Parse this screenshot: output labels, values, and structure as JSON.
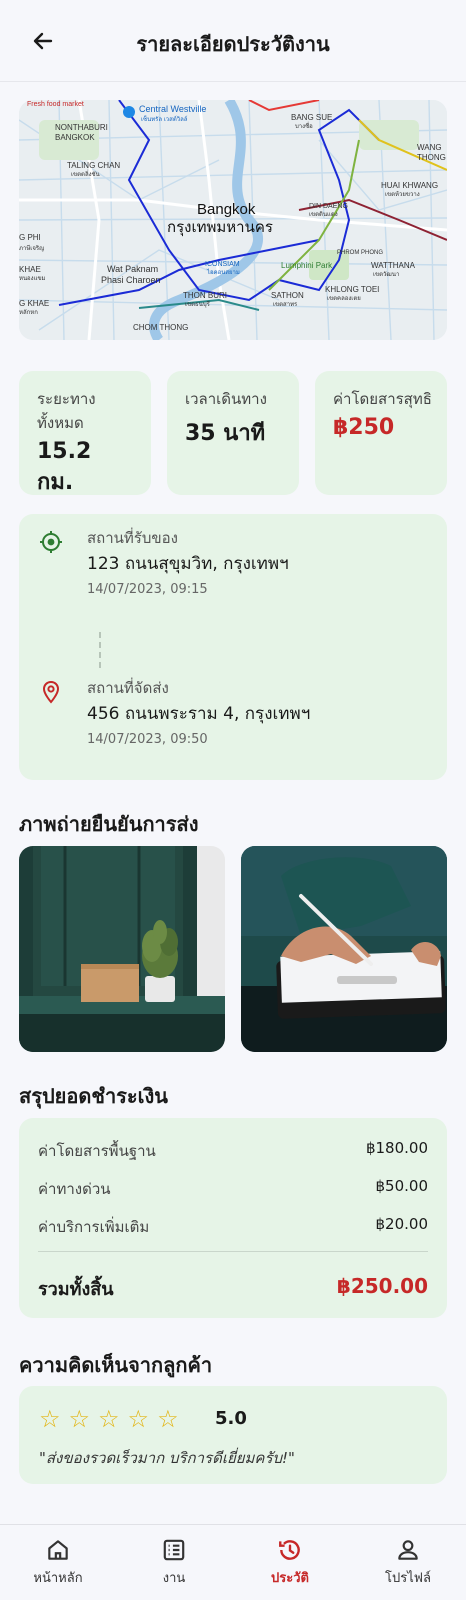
{
  "header": {
    "title": "รายละเอียดประวัติงาน"
  },
  "map": {
    "labels": {
      "fresh_food": "Fresh food market",
      "central_westville": "Central Westville",
      "central_westville_th": "เซ็นทรัล เวสต์วิลล์",
      "nonthaburi": "NONTHABURI",
      "bangkok_noi": "BANGKOK",
      "taling_chan": "TALING CHAN",
      "taling_chan_th": "เขตตลิ่งชัน",
      "bang_sue": "BANG SUE",
      "bang_sue_th": "บางซื่อ",
      "wang": "WANG",
      "thong": "THONG",
      "huai_khwang": "HUAI KHWANG",
      "huai_khwang_th": "เขตห้วยขวาง",
      "bangkok": "Bangkok",
      "bangkok_th": "กรุงเทพมหานคร",
      "din_daeng": "DIN DAENG",
      "din_daeng_th": "เขตดินแดง",
      "phi_a": "G PHI",
      "phi_th": "ภาษีเจริญ",
      "lumphini": "Lumphini Park",
      "phrom_phong": "PHROM PHONG",
      "watthana": "WATTHANA",
      "watthana_th": "เขตวัฒนา",
      "iconsiam": "ICONSIAM",
      "iconsiam_th": "ไอคอนสยาม",
      "wat_paknam": "Wat Paknam",
      "wat_paknam_sub": "Phasi Charoen",
      "thon_buri": "THON BURI",
      "thon_buri_th": "เขตธนบุรี",
      "sathon": "SATHON",
      "sathon_th": "เขตสาทร",
      "khlong_toei": "KHLONG TOEI",
      "khlong_toei_th": "เขตคลองเตย",
      "chom_thong": "CHOM THONG",
      "khae": "KHAE",
      "khae_th": "หนองแขม",
      "g_khae": "G KHAE",
      "g_khae_th": "หลักหก"
    }
  },
  "stats": [
    {
      "label": "ระยะทางทั้งหมด",
      "value": "15.2 กม."
    },
    {
      "label": "เวลาเดินทาง",
      "value": "35 นาที"
    },
    {
      "label": "ค่าโดยสารสุทธิ",
      "value": "฿250"
    }
  ],
  "route": {
    "pickup": {
      "label": "สถานที่รับของ",
      "address": "123 ถนนสุขุมวิท, กรุงเทพฯ",
      "time": "14/07/2023, 09:15"
    },
    "dropoff": {
      "label": "สถานที่จัดส่ง",
      "address": "456 ถนนพระราม 4, กรุงเทพฯ",
      "time": "14/07/2023, 09:50"
    }
  },
  "photos": {
    "title": "ภาพถ่ายยืนยันการส่ง"
  },
  "payment": {
    "title": "สรุปยอดชำระเงิน",
    "rows": [
      {
        "label": "ค่าโดยสารพื้นฐาน",
        "amount": "฿180.00"
      },
      {
        "label": "ค่าทางด่วน",
        "amount": "฿50.00"
      },
      {
        "label": "ค่าบริการเพิ่มเติม",
        "amount": "฿20.00"
      }
    ],
    "total_label": "รวมทั้งสิ้น",
    "total_amount": "฿250.00"
  },
  "review": {
    "title": "ความคิดเห็นจากลูกค้า",
    "rating": "5.0",
    "stars": 5,
    "comment": "\"ส่งของรวดเร็วมาก บริการดีเยี่ยมครับ!\""
  },
  "nav": [
    {
      "label": "หน้าหลัก",
      "icon": "home-icon",
      "active": false
    },
    {
      "label": "งาน",
      "icon": "list-icon",
      "active": false
    },
    {
      "label": "ประวัติ",
      "icon": "history-icon",
      "active": true
    },
    {
      "label": "โปรไฟล์",
      "icon": "person-icon",
      "active": false
    }
  ],
  "colors": {
    "accent": "#c62828",
    "card": "#e6f4e7",
    "pickup": "#2e7d32",
    "star": "#e2b513"
  }
}
